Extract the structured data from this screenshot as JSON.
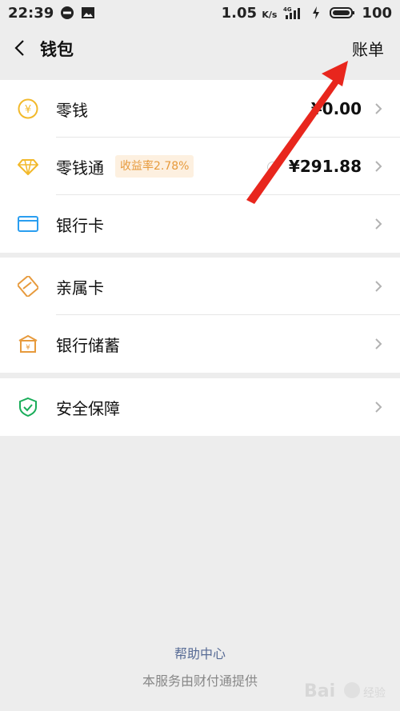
{
  "status_bar": {
    "time": "22:39",
    "network_speed": "1.05",
    "speed_unit": "K/s",
    "network_type": "4G",
    "battery": "100"
  },
  "nav": {
    "title": "钱包",
    "bill_label": "账单"
  },
  "groups": [
    {
      "items": [
        {
          "label": "零钱",
          "value": "¥0.00",
          "icon": "coin-icon"
        },
        {
          "label": "零钱通",
          "badge": "收益率2.78%",
          "value": "¥291.88",
          "icon": "diamond-icon"
        },
        {
          "label": "银行卡",
          "value": "",
          "icon": "card-icon"
        }
      ]
    },
    {
      "items": [
        {
          "label": "亲属卡",
          "value": "",
          "icon": "family-card-icon"
        },
        {
          "label": "银行储蓄",
          "value": "",
          "icon": "bank-icon"
        }
      ]
    },
    {
      "items": [
        {
          "label": "安全保障",
          "value": "",
          "icon": "shield-icon"
        }
      ]
    }
  ],
  "footer": {
    "help_link": "帮助中心",
    "provider_note": "本服务由财付通提供"
  },
  "colors": {
    "accent_yellow": "#f2b92b",
    "card_blue": "#2a9ef0",
    "orange": "#e79a3c",
    "green": "#1aad5a",
    "link": "#576b95"
  }
}
